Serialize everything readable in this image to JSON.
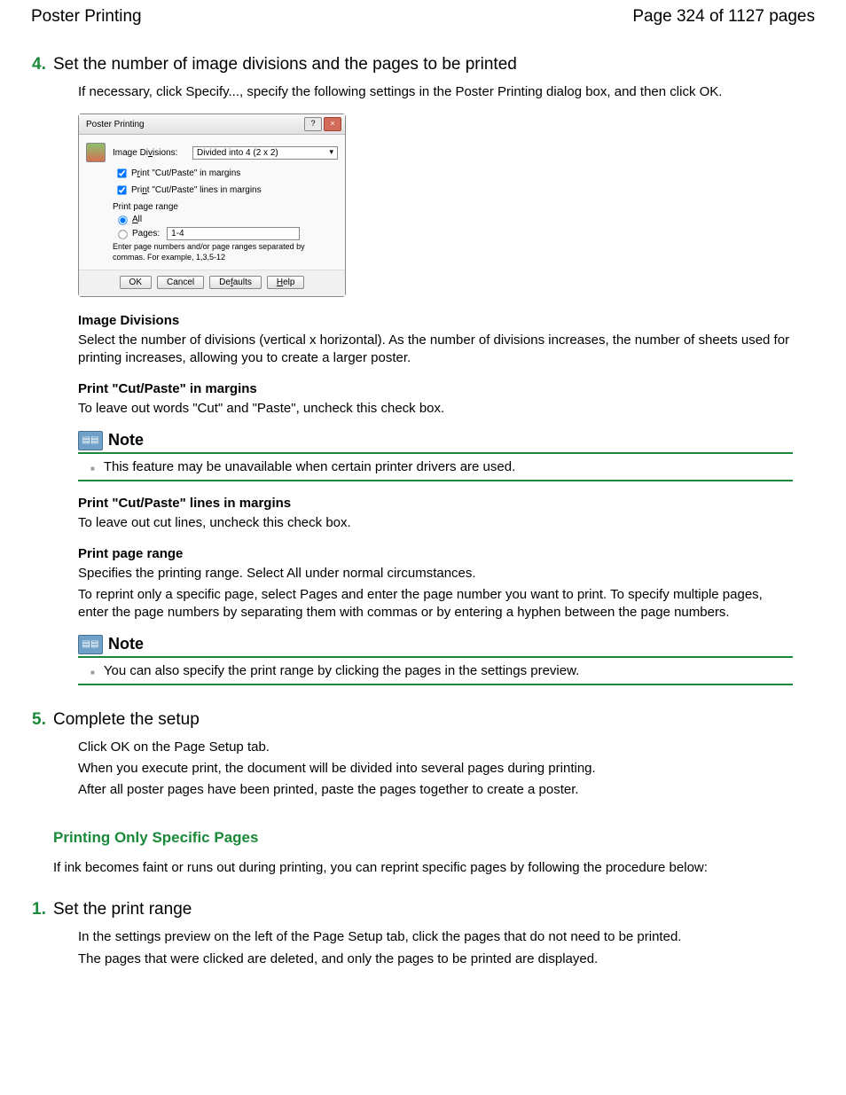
{
  "header": {
    "title": "Poster Printing",
    "pager": "Page 324 of 1127 pages"
  },
  "step4": {
    "num": "4.",
    "title": "Set the number of image divisions and the pages to be printed",
    "intro": "If necessary, click Specify..., specify the following settings in the Poster Printing dialog box, and then click OK."
  },
  "dialog": {
    "title": "Poster Printing",
    "help_btn": "?",
    "close_btn": "×",
    "image_divisions_label_pre": "Image Di",
    "image_divisions_label_u": "v",
    "image_divisions_label_post": "isions:",
    "image_divisions_value": "Divided into 4 (2 x 2)",
    "cb1_pre": "P",
    "cb1_u": "r",
    "cb1_post": "int \"Cut/Paste\" in margins",
    "cb2_pre": "Pri",
    "cb2_u": "n",
    "cb2_post": "t \"Cut/Paste\" lines in margins",
    "range_group": "Print page range",
    "radio_all_u": "A",
    "radio_all_post": "ll",
    "radio_pages_pre": "Pa",
    "radio_pages_u": "g",
    "radio_pages_post": "es:",
    "pages_value": "1-4",
    "hint": "Enter page numbers and/or page ranges separated by commas. For example, 1,3,5-12",
    "ok": "OK",
    "cancel": "Cancel",
    "defaults_pre": "De",
    "defaults_u": "f",
    "defaults_post": "aults",
    "help_u": "H",
    "help_post": "elp"
  },
  "defs": {
    "d1_title": "Image Divisions",
    "d1_text": "Select the number of divisions (vertical x horizontal). As the number of divisions increases, the number of sheets used for printing increases, allowing you to create a larger poster.",
    "d2_title": "Print \"Cut/Paste\" in margins",
    "d2_text": "To leave out words \"Cut\" and \"Paste\", uncheck this check box.",
    "d3_title": "Print \"Cut/Paste\" lines in margins",
    "d3_text": "To leave out cut lines, uncheck this check box.",
    "d4_title": "Print page range",
    "d4_text1": "Specifies the printing range. Select All under normal circumstances.",
    "d4_text2": "To reprint only a specific page, select Pages and enter the page number you want to print. To specify multiple pages, enter the page numbers by separating them with commas or by entering a hyphen between the page numbers."
  },
  "note_label": "Note",
  "note1": "This feature may be unavailable when certain printer drivers are used.",
  "note2": "You can also specify the print range by clicking the pages in the settings preview.",
  "step5": {
    "num": "5.",
    "title": "Complete the setup",
    "p1": "Click OK on the Page Setup tab.",
    "p2": "When you execute print, the document will be divided into several pages during printing.",
    "p3": "After all poster pages have been printed, paste the pages together to create a poster."
  },
  "section2": {
    "heading": "Printing Only Specific Pages",
    "intro": "If ink becomes faint or runs out during printing, you can reprint specific pages by following the procedure below:"
  },
  "s2step1": {
    "num": "1.",
    "title": "Set the print range",
    "p1": "In the settings preview on the left of the Page Setup tab, click the pages that do not need to be printed.",
    "p2": "The pages that were clicked are deleted, and only the pages to be printed are displayed."
  }
}
